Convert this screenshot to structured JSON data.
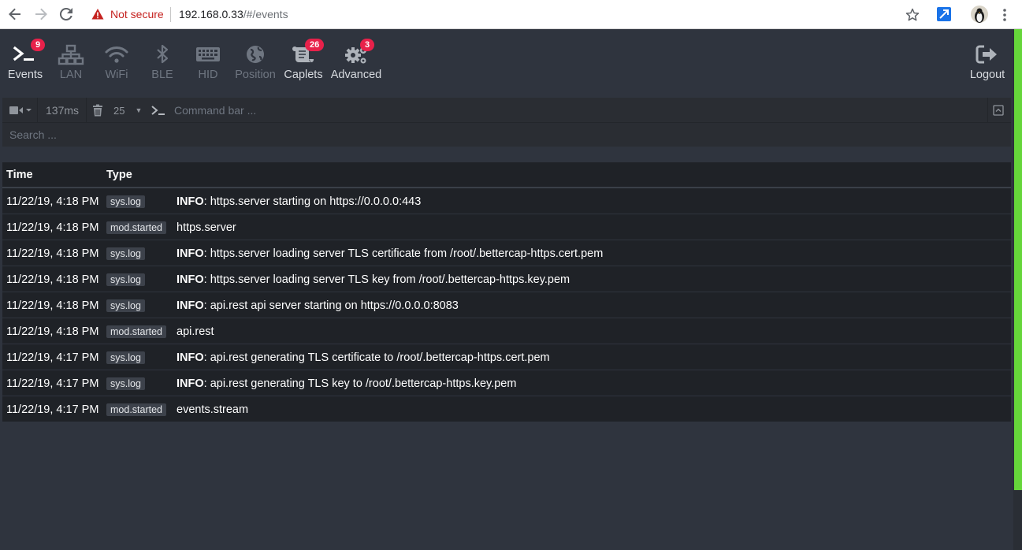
{
  "browser": {
    "security_label": "Not secure",
    "url_host": "192.168.0.33",
    "url_path": "/#/events"
  },
  "nav": {
    "items": [
      {
        "label": "Events",
        "icon": "terminal-icon",
        "badge": "9"
      },
      {
        "label": "LAN",
        "icon": "network-icon"
      },
      {
        "label": "WiFi",
        "icon": "wifi-icon"
      },
      {
        "label": "BLE",
        "icon": "bluetooth-icon"
      },
      {
        "label": "HID",
        "icon": "keyboard-icon"
      },
      {
        "label": "Position",
        "icon": "globe-icon"
      },
      {
        "label": "Caplets",
        "icon": "scroll-icon",
        "badge": "26"
      },
      {
        "label": "Advanced",
        "icon": "cogs-icon",
        "badge": "3"
      }
    ],
    "logout_label": "Logout"
  },
  "toolbar": {
    "latency": "137ms",
    "limit": "25",
    "command_placeholder": "Command bar ..."
  },
  "search": {
    "placeholder": "Search ..."
  },
  "table": {
    "headers": {
      "time": "Time",
      "type": "Type"
    },
    "rows": [
      {
        "time": "11/22/19, 4:18 PM",
        "type": "sys.log",
        "level": "INFO",
        "message": ": https.server starting on https://0.0.0.0:443"
      },
      {
        "time": "11/22/19, 4:18 PM",
        "type": "mod.started",
        "level": "",
        "message": "https.server"
      },
      {
        "time": "11/22/19, 4:18 PM",
        "type": "sys.log",
        "level": "INFO",
        "message": ": https.server loading server TLS certificate from /root/.bettercap-https.cert.pem"
      },
      {
        "time": "11/22/19, 4:18 PM",
        "type": "sys.log",
        "level": "INFO",
        "message": ": https.server loading server TLS key from /root/.bettercap-https.key.pem"
      },
      {
        "time": "11/22/19, 4:18 PM",
        "type": "sys.log",
        "level": "INFO",
        "message": ": api.rest api server starting on https://0.0.0.0:8083"
      },
      {
        "time": "11/22/19, 4:18 PM",
        "type": "mod.started",
        "level": "",
        "message": "api.rest"
      },
      {
        "time": "11/22/19, 4:17 PM",
        "type": "sys.log",
        "level": "INFO",
        "message": ": api.rest generating TLS certificate to /root/.bettercap-https.cert.pem"
      },
      {
        "time": "11/22/19, 4:17 PM",
        "type": "sys.log",
        "level": "INFO",
        "message": ": api.rest generating TLS key to /root/.bettercap-https.key.pem"
      },
      {
        "time": "11/22/19, 4:17 PM",
        "type": "mod.started",
        "level": "",
        "message": "events.stream"
      }
    ]
  },
  "colors": {
    "badge": "#e8214a",
    "scroll_thumb": "#66d63a",
    "background": "#2f343e"
  }
}
